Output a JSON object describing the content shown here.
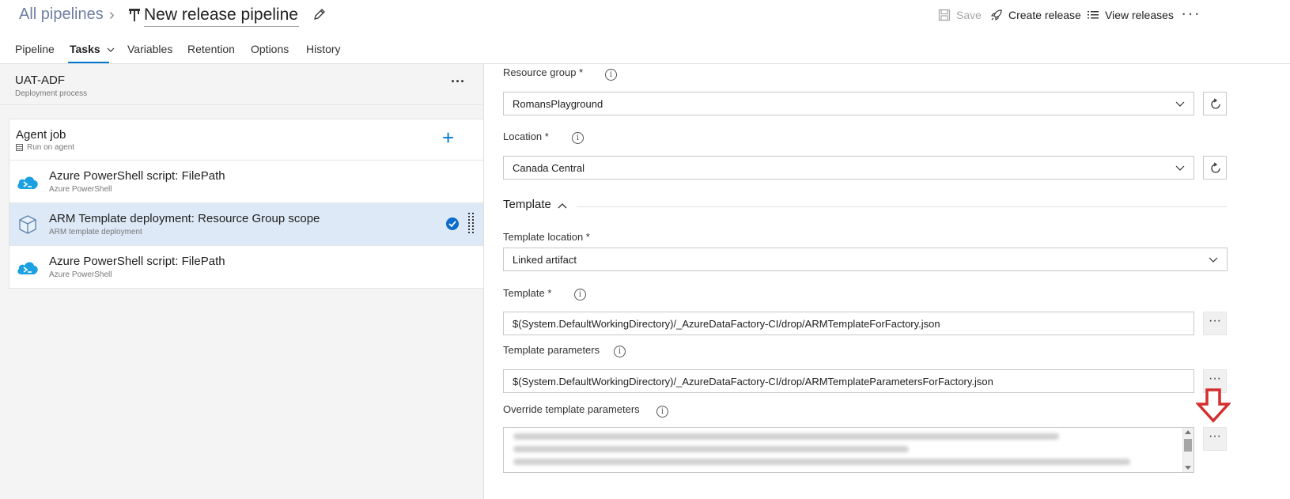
{
  "header": {
    "breadcrumb": "All pipelines",
    "title": "New release pipeline",
    "actions": {
      "save": "Save",
      "create_release": "Create release",
      "view_releases": "View releases",
      "more": "···"
    }
  },
  "tabs": [
    {
      "label": "Pipeline"
    },
    {
      "label": "Tasks"
    },
    {
      "label": "Variables"
    },
    {
      "label": "Retention"
    },
    {
      "label": "Options"
    },
    {
      "label": "History"
    }
  ],
  "left_panel": {
    "stage": {
      "name": "UAT-ADF",
      "subtitle": "Deployment process",
      "more": "···"
    },
    "agent_job": {
      "name": "Agent job",
      "subtitle": "Run on agent",
      "add": "+"
    },
    "tasks": [
      {
        "name": "Azure PowerShell script: FilePath",
        "subtitle": "Azure PowerShell",
        "icon": "azure-powershell-icon"
      },
      {
        "name": "ARM Template deployment: Resource Group scope",
        "subtitle": "ARM template deployment",
        "icon": "arm-template-icon",
        "selected": true
      },
      {
        "name": "Azure PowerShell script: FilePath",
        "subtitle": "Azure PowerShell",
        "icon": "azure-powershell-icon"
      }
    ]
  },
  "right_panel": {
    "resource_group": {
      "label": "Resource group *",
      "value": "RomansPlayground"
    },
    "location": {
      "label": "Location *",
      "value": "Canada Central"
    },
    "template_section": {
      "title": "Template"
    },
    "template_location": {
      "label": "Template location *",
      "value": "Linked artifact"
    },
    "template": {
      "label": "Template *",
      "value": "$(System.DefaultWorkingDirectory)/_AzureDataFactory-CI/drop/ARMTemplateForFactory.json"
    },
    "template_parameters": {
      "label": "Template parameters",
      "value": "$(System.DefaultWorkingDirectory)/_AzureDataFactory-CI/drop/ARMTemplateParametersForFactory.json"
    },
    "override_parameters": {
      "label": "Override template parameters"
    },
    "ellipsis": "···",
    "info": "i"
  },
  "colors": {
    "accent": "#0078d4",
    "selected_row": "#dde9f6",
    "annotation_arrow": "#d32f2f"
  }
}
